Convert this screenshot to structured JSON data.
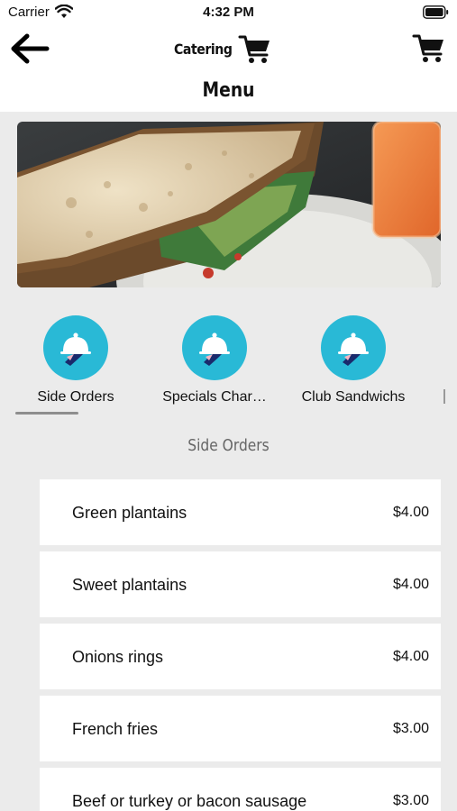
{
  "status_bar": {
    "carrier": "Carrier",
    "time": "4:32 PM"
  },
  "nav": {
    "title": "Catering",
    "heading": "Menu"
  },
  "icons": {
    "back": "arrow-left-icon",
    "cart": "shopping-cart-icon",
    "category": "serving-cloche-icon"
  },
  "colors": {
    "accent": "#29b9d6",
    "background": "#ebebeb",
    "card": "#ffffff",
    "indicator": "#8e8e8e"
  },
  "categories": [
    {
      "label": "Side Orders",
      "active": true
    },
    {
      "label": "Specials Char…",
      "active": false
    },
    {
      "label": "Club Sandwichs",
      "active": false
    }
  ],
  "section_title": "Side Orders",
  "menu_items": [
    {
      "name": "Green plantains",
      "price": "$4.00"
    },
    {
      "name": "Sweet plantains",
      "price": "$4.00"
    },
    {
      "name": "Onions rings",
      "price": "$4.00"
    },
    {
      "name": "French fries",
      "price": "$3.00"
    },
    {
      "name": "Beef or turkey or bacon sausage",
      "price": "$3.00"
    }
  ]
}
